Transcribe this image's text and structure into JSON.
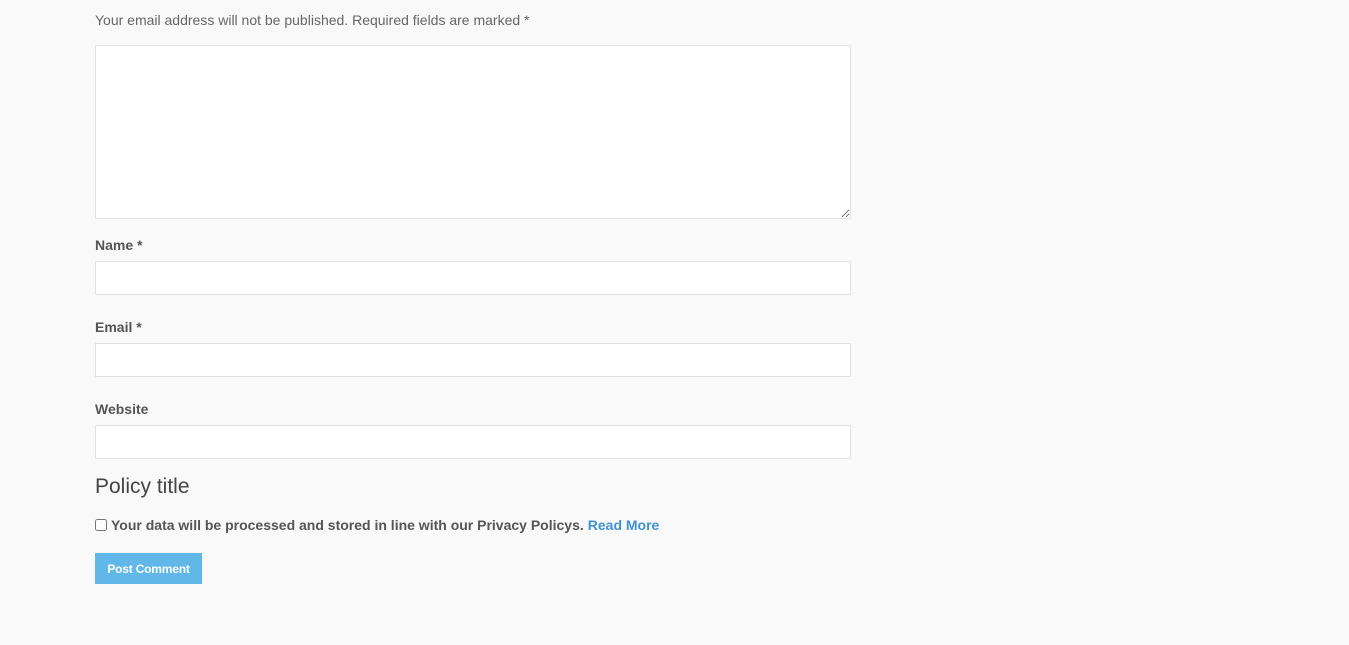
{
  "form": {
    "notes": "Your email address will not be published. Required fields are marked *",
    "comment": {
      "value": "",
      "placeholder": ""
    },
    "name": {
      "label": "Name *",
      "value": "",
      "placeholder": ""
    },
    "email": {
      "label": "Email *",
      "value": "",
      "placeholder": ""
    },
    "website": {
      "label": "Website",
      "value": "",
      "placeholder": ""
    },
    "policy_title": "Policy title",
    "consent": {
      "text": "Your data will be processed and stored in line with our Privacy Policys.",
      "link_text": "Read More",
      "checked": false
    },
    "submit_label": "Post Comment"
  },
  "colors": {
    "background": "#f9f9f9",
    "accent": "#60b7e8",
    "link": "#4193cf",
    "text": "#555555"
  }
}
